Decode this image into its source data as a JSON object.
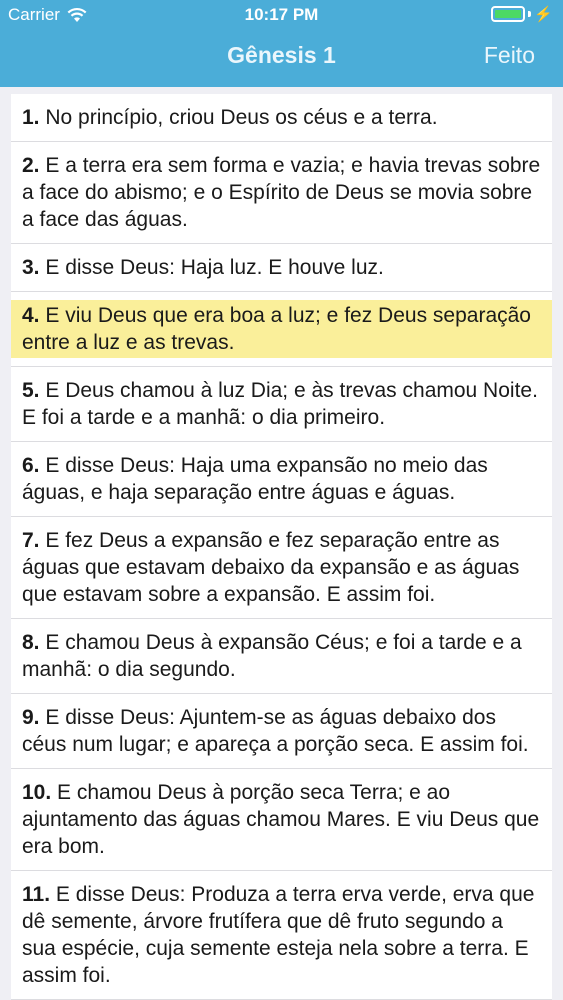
{
  "status_bar": {
    "carrier": "Carrier",
    "time": "10:17 PM",
    "battery_level": 1.0,
    "icons": [
      "wifi-icon",
      "battery-icon",
      "charging-bolt-icon"
    ]
  },
  "nav": {
    "title": "Gênesis 1",
    "done_label": "Feito"
  },
  "colors": {
    "header_bg": "#4badd8",
    "highlight": "#faef9a"
  },
  "verses": [
    {
      "num": "1.",
      "text": " No princípio, criou Deus os céus e a terra.",
      "highlighted": false
    },
    {
      "num": "2.",
      "text": " E a terra era sem forma e vazia; e havia trevas sobre a face do abismo; e o Espírito de Deus se movia sobre a face das águas.",
      "highlighted": false
    },
    {
      "num": "3.",
      "text": " E disse Deus: Haja luz. E houve luz.",
      "highlighted": false
    },
    {
      "num": "4.",
      "text": " E viu Deus que era boa a luz; e fez Deus separação entre a luz e as trevas.",
      "highlighted": true
    },
    {
      "num": "5.",
      "text": " E Deus chamou à luz Dia; e às trevas chamou Noite. E foi a tarde e a manhã: o dia primeiro.",
      "highlighted": false
    },
    {
      "num": "6.",
      "text": " E disse Deus: Haja uma expansão no meio das águas, e haja separação entre águas e águas.",
      "highlighted": false
    },
    {
      "num": "7.",
      "text": " E fez Deus a expansão e fez separação entre as águas que estavam debaixo da expansão e as águas que estavam sobre a expansão. E assim foi.",
      "highlighted": false
    },
    {
      "num": "8.",
      "text": " E chamou Deus à expansão Céus; e foi a tarde e a manhã: o dia segundo.",
      "highlighted": false
    },
    {
      "num": "9.",
      "text": " E disse Deus: Ajuntem-se as águas debaixo dos céus num lugar; e apareça a porção seca. E assim foi.",
      "highlighted": false
    },
    {
      "num": "10.",
      "text": " E chamou Deus à porção seca Terra; e ao ajuntamento das águas chamou Mares. E viu Deus que era bom.",
      "highlighted": false
    },
    {
      "num": "11.",
      "text": " E disse Deus: Produza a terra erva verde, erva que dê semente, árvore frutífera que dê fruto segundo a sua espécie, cuja semente esteja nela sobre a terra. E assim foi.",
      "highlighted": false
    }
  ]
}
